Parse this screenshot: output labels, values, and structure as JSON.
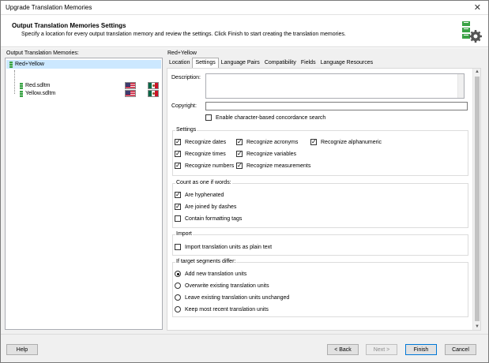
{
  "window": {
    "title": "Upgrade Translation Memories",
    "close_glyph": "✕"
  },
  "header": {
    "title": "Output Translation Memories Settings",
    "subtitle": "Specify a location for every output translation memory and review the settings. Click Finish to start creating the translation memories.",
    "icon": "translation-memory-settings-icon"
  },
  "left": {
    "label": "Output Translation Memories:",
    "root": "Red+Yellow",
    "items": [
      {
        "name": "Red.sdltm",
        "source_flag": "us-flag",
        "target_flag": "mexico-flag"
      },
      {
        "name": "Yellow.sdltm",
        "source_flag": "us-flag",
        "target_flag": "mexico-flag"
      }
    ]
  },
  "right": {
    "label": "Red+Yellow",
    "tabs": [
      "Location",
      "Settings",
      "Language Pairs",
      "Compatibility",
      "Fields",
      "Language Resources"
    ],
    "active_tab": "Settings"
  },
  "form": {
    "description_label": "Description:",
    "description_value": "",
    "copyright_label": "Copyright:",
    "copyright_value": "",
    "concordance": {
      "label": "Enable character-based concordance search",
      "checked": false
    }
  },
  "settings": {
    "title": "Settings",
    "options": [
      {
        "label": "Recognize dates",
        "checked": true
      },
      {
        "label": "Recognize times",
        "checked": true
      },
      {
        "label": "Recognize numbers",
        "checked": true
      },
      {
        "label": "Recognize acronyms",
        "checked": true
      },
      {
        "label": "Recognize variables",
        "checked": true
      },
      {
        "label": "Recognize measurements",
        "checked": true
      },
      {
        "label": "Recognize alphanumeric",
        "checked": true
      }
    ]
  },
  "count_words": {
    "title": "Count as one if words:",
    "options": [
      {
        "label": "Are hyphenated",
        "checked": true
      },
      {
        "label": "Are joined by dashes",
        "checked": true
      },
      {
        "label": "Contain formatting tags",
        "checked": false
      }
    ]
  },
  "import": {
    "title": "Import",
    "option": {
      "label": "Import translation units as plain text",
      "checked": false
    }
  },
  "target_differ": {
    "title": "If target segments differ:",
    "options": [
      {
        "label": "Add new translation units",
        "selected": true
      },
      {
        "label": "Overwrite existing translation units",
        "selected": false
      },
      {
        "label": "Leave existing translation units unchanged",
        "selected": false
      },
      {
        "label": "Keep most recent translation units",
        "selected": false
      }
    ]
  },
  "footer": {
    "help": "Help",
    "back": "< Back",
    "next": "Next >",
    "finish": "Finish",
    "cancel": "Cancel"
  },
  "colors": {
    "selection": "#cce8ff",
    "accent": "#0078d7",
    "tm_icon": "#3aa345"
  }
}
